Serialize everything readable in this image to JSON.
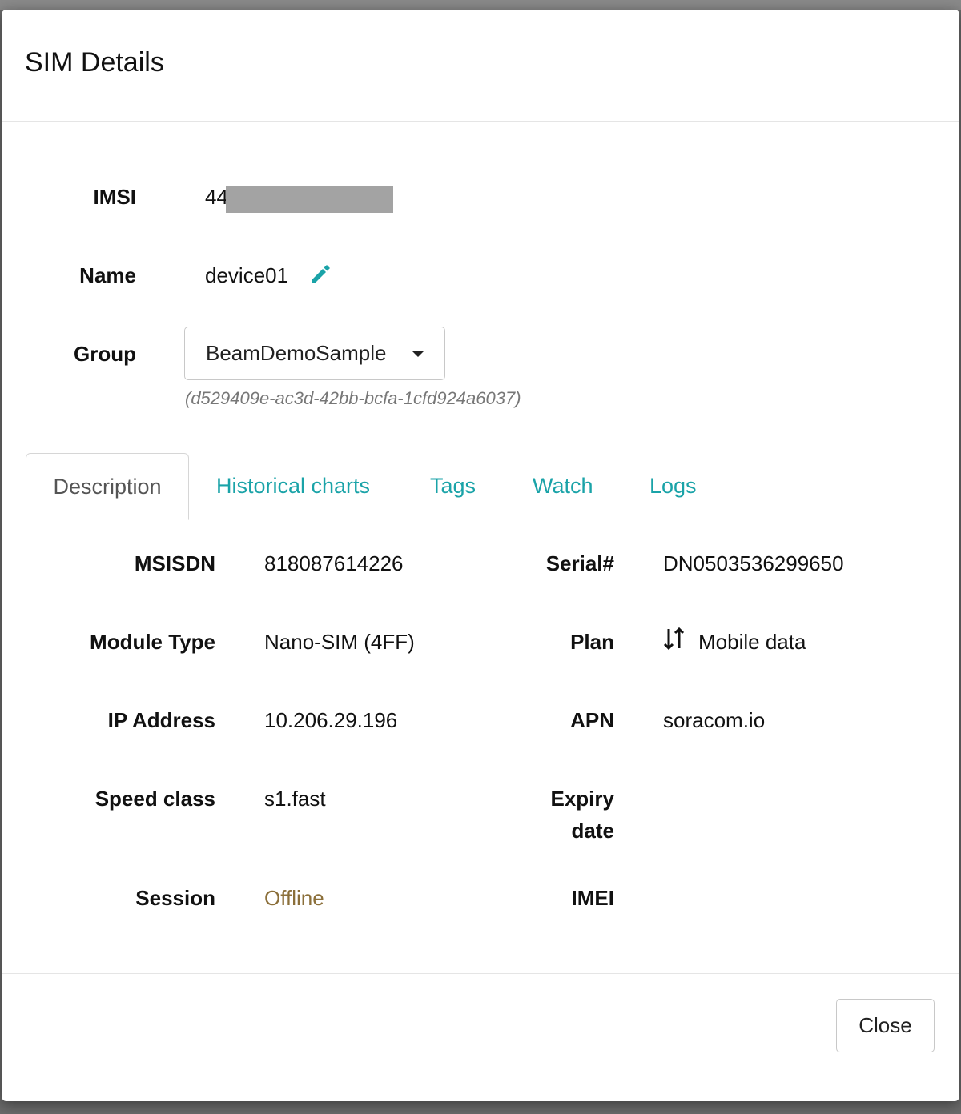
{
  "modal": {
    "title": "SIM Details"
  },
  "sim": {
    "imsi_label": "IMSI",
    "imsi_value": "44",
    "name_label": "Name",
    "name_value": "device01",
    "name_edit_icon": "pencil-icon",
    "group_label": "Group",
    "group_selected": "BeamDemoSample",
    "group_id": "(d529409e-ac3d-42bb-bcfa-1cfd924a6037)"
  },
  "tabs": [
    {
      "label": "Description",
      "active": true
    },
    {
      "label": "Historical charts",
      "active": false
    },
    {
      "label": "Tags",
      "active": false
    },
    {
      "label": "Watch",
      "active": false
    },
    {
      "label": "Logs",
      "active": false
    }
  ],
  "description": {
    "msisdn_label": "MSISDN",
    "msisdn_value": "818087614226",
    "serial_label": "Serial#",
    "serial_value": "DN0503536299650",
    "module_type_label": "Module Type",
    "module_type_value": "Nano-SIM (4FF)",
    "plan_label": "Plan",
    "plan_icon": "up-down-arrows-icon",
    "plan_value": "Mobile data",
    "ip_label": "IP Address",
    "ip_value": "10.206.29.196",
    "apn_label": "APN",
    "apn_value": "soracom.io",
    "speed_label": "Speed class",
    "speed_value": "s1.fast",
    "expiry_label_line1": "Expiry",
    "expiry_label_line2": "date",
    "session_label": "Session",
    "session_value": "Offline",
    "imei_label": "IMEI"
  },
  "footer": {
    "close_label": "Close"
  },
  "colors": {
    "accent": "#1aa3a8",
    "offline": "#8b6f3a"
  }
}
